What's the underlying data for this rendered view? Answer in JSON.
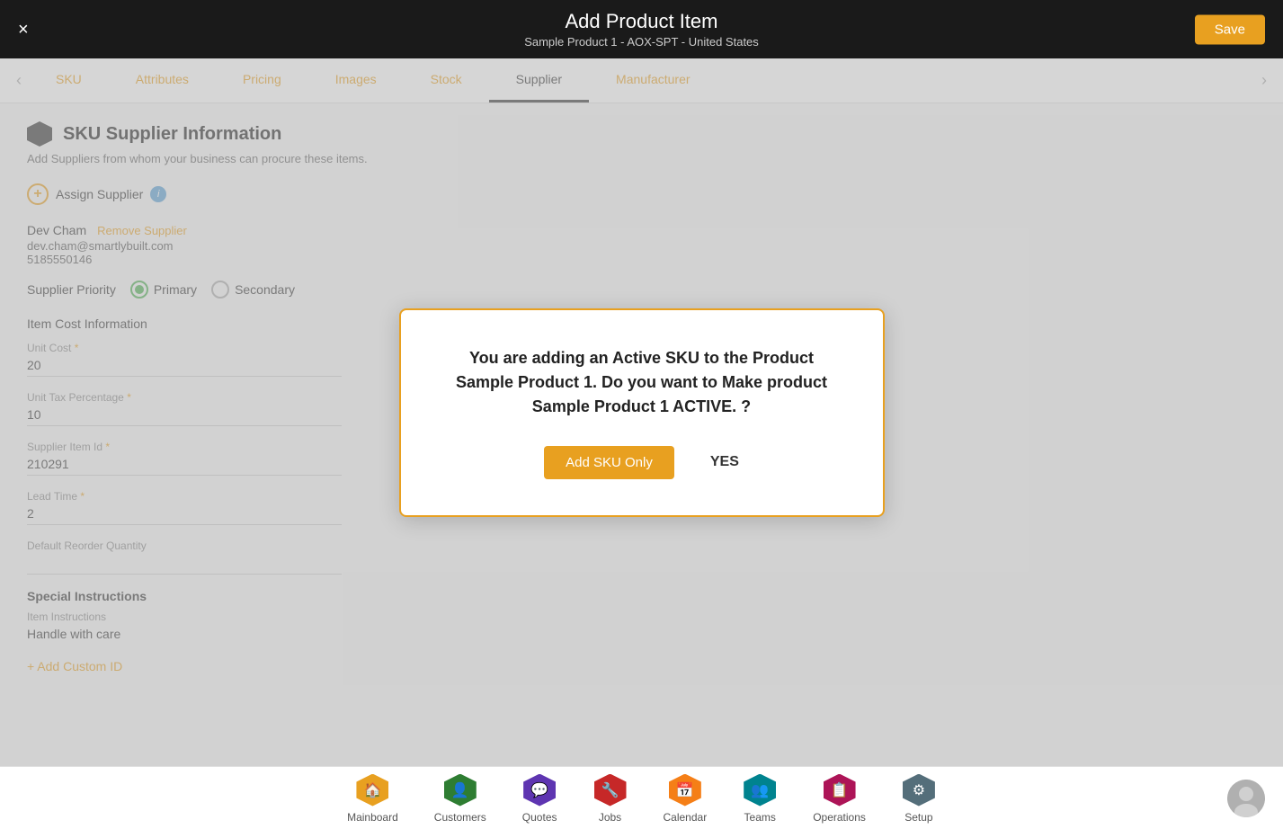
{
  "header": {
    "title": "Add Product Item",
    "subtitle": "Sample Product 1 - AOX-SPT - United States",
    "close_label": "×",
    "save_label": "Save"
  },
  "tabs": {
    "items": [
      {
        "label": "SKU",
        "active": false
      },
      {
        "label": "Attributes",
        "active": false
      },
      {
        "label": "Pricing",
        "active": false
      },
      {
        "label": "Images",
        "active": false
      },
      {
        "label": "Stock",
        "active": false
      },
      {
        "label": "Supplier",
        "active": true
      },
      {
        "label": "Manufacturer",
        "active": false
      }
    ]
  },
  "section": {
    "title": "SKU Supplier Information",
    "description": "Add Suppliers from whom your business can procure these items.",
    "assign_label": "Assign Supplier"
  },
  "supplier": {
    "name": "Dev Cham",
    "remove_label": "Remove Supplier",
    "email": "dev.cham@smartlybuilt.com",
    "phone": "5185550146"
  },
  "priority": {
    "label": "Supplier Priority",
    "options": [
      {
        "label": "Primary",
        "selected": true
      },
      {
        "label": "Secondary",
        "selected": false
      }
    ]
  },
  "cost_section": {
    "title": "Item Cost Information",
    "fields": [
      {
        "label": "Unit Cost",
        "required": true,
        "value": "20"
      },
      {
        "label": "Unit Tax Percentage",
        "required": true,
        "value": "10"
      },
      {
        "label": "Supplier Item Id",
        "required": true,
        "value": "210291"
      },
      {
        "label": "Lead Time",
        "required": true,
        "value": "2"
      },
      {
        "label": "Default Reorder Quantity",
        "required": false,
        "value": ""
      }
    ]
  },
  "special_instructions": {
    "title": "Special Instructions",
    "item_instructions_label": "Item Instructions",
    "item_instructions_value": "Handle with care"
  },
  "add_custom_id_label": "+ Add Custom ID",
  "modal": {
    "message": "You are adding an Active SKU to the Product Sample Product 1. Do you want to Make product Sample Product 1 ACTIVE. ?",
    "btn_add_sku": "Add SKU Only",
    "btn_yes": "YES"
  },
  "bottom_nav": {
    "items": [
      {
        "label": "Mainboard",
        "color": "#e8a020",
        "icon": "🏠"
      },
      {
        "label": "Customers",
        "color": "#2e7d32",
        "icon": "👤"
      },
      {
        "label": "Quotes",
        "color": "#5e35b1",
        "icon": "💬"
      },
      {
        "label": "Jobs",
        "color": "#c62828",
        "icon": "🔧"
      },
      {
        "label": "Calendar",
        "color": "#f57f17",
        "icon": "📅"
      },
      {
        "label": "Teams",
        "color": "#00838f",
        "icon": "👥"
      },
      {
        "label": "Operations",
        "color": "#ad1457",
        "icon": "📋"
      },
      {
        "label": "Setup",
        "color": "#546e7a",
        "icon": "⚙"
      }
    ]
  }
}
